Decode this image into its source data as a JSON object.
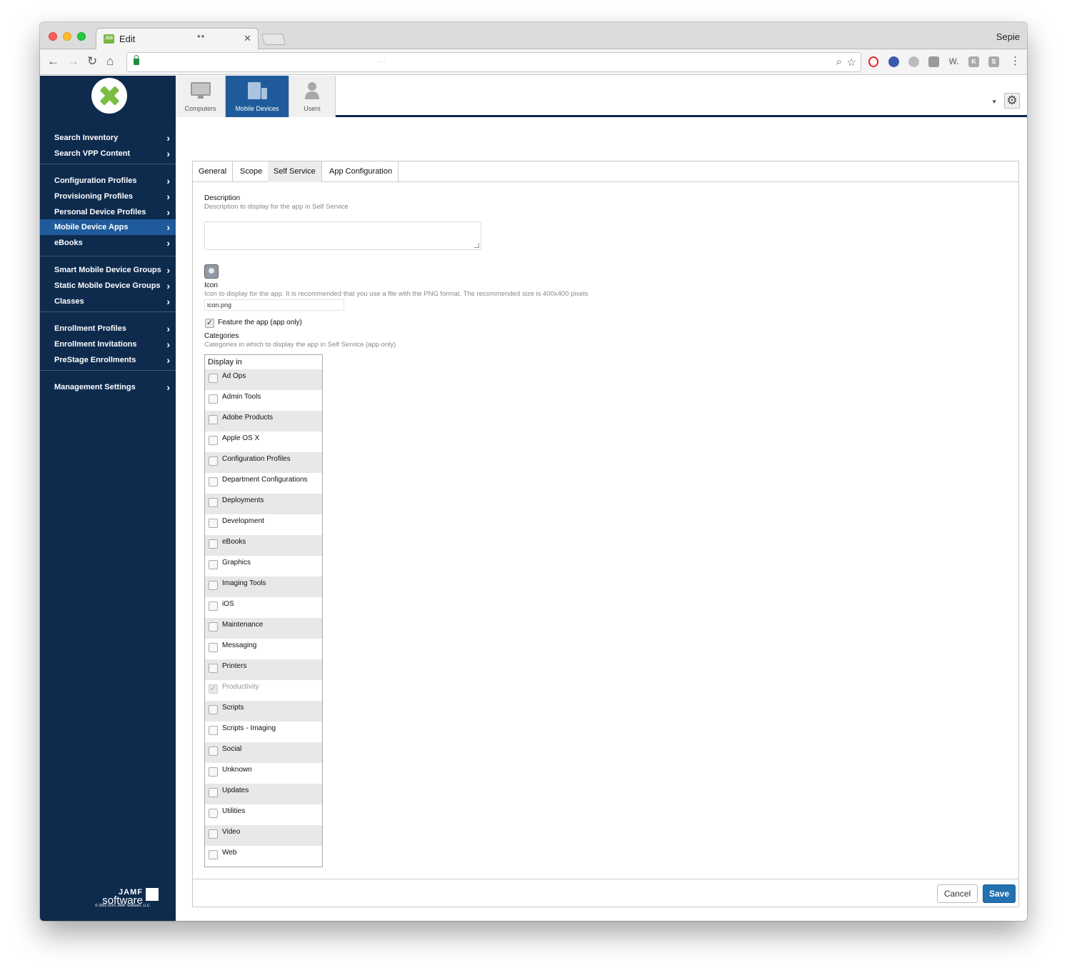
{
  "browser": {
    "tab_title": "Edit",
    "tab_stars": "**",
    "tab_favicon": "JSS",
    "profile_name": "Sepie",
    "url_text": ". ."
  },
  "colors": {
    "sidebar_bg": "#0e2b4e",
    "active_blue": "#1f5b9b",
    "save_blue": "#2271b1",
    "jamf_green": "#79bd43"
  },
  "device_tabs": [
    {
      "label": "Computers",
      "icon": "computer-icon"
    },
    {
      "label": "Mobile Devices",
      "icon": "mobile-devices-icon"
    },
    {
      "label": "Users",
      "icon": "user-icon"
    }
  ],
  "sidebar": {
    "group1": [
      "Search Inventory",
      "Search VPP Content"
    ],
    "group2": [
      "Configuration Profiles",
      "Provisioning Profiles",
      "Personal Device Profiles",
      "Mobile Device Apps",
      "eBooks"
    ],
    "group3": [
      "Smart Mobile Device Groups",
      "Static Mobile Device Groups",
      "Classes"
    ],
    "group4": [
      "Enrollment Profiles",
      "Enrollment Invitations",
      "PreStage Enrollments"
    ],
    "group5": [
      "Management Settings"
    ],
    "active_item": "Mobile Device Apps",
    "footer_logo_top": "JAMF",
    "footer_logo_bottom": "software",
    "footer_copyright": "© 2002-2016 JAMF Software, LLC."
  },
  "panel_tabs": [
    "General",
    "Scope",
    "Self Service",
    "App Configuration"
  ],
  "active_panel_tab": "Self Service",
  "form": {
    "description_label": "Description",
    "description_hint": "Description to display for the app in Self Service",
    "description_value": "",
    "icon_label": "Icon",
    "icon_hint": "Icon to display for the app. It is recommended that you use a file with the PNG format. The recommended size is 400x400 pixels",
    "icon_file": "icon.png",
    "feature_label": "Feature the app (app only)",
    "feature_checked": true,
    "categories_label": "Categories",
    "categories_hint": "Categories in which to display the app in Self Service (app only)",
    "display_in_header": "Display in",
    "categories": [
      {
        "name": "Ad Ops",
        "checked": false,
        "disabled": false
      },
      {
        "name": "Admin Tools",
        "checked": false,
        "disabled": false
      },
      {
        "name": "Adobe Products",
        "checked": false,
        "disabled": false
      },
      {
        "name": "Apple OS X",
        "checked": false,
        "disabled": false
      },
      {
        "name": "Configuration Profiles",
        "checked": false,
        "disabled": false
      },
      {
        "name": "Department Configurations",
        "checked": false,
        "disabled": false
      },
      {
        "name": "Deployments",
        "checked": false,
        "disabled": false
      },
      {
        "name": "Development",
        "checked": false,
        "disabled": false
      },
      {
        "name": "eBooks",
        "checked": false,
        "disabled": false
      },
      {
        "name": "Graphics",
        "checked": false,
        "disabled": false
      },
      {
        "name": "Imaging Tools",
        "checked": false,
        "disabled": false
      },
      {
        "name": "iOS",
        "checked": false,
        "disabled": false
      },
      {
        "name": "Maintenance",
        "checked": false,
        "disabled": false
      },
      {
        "name": "Messaging",
        "checked": false,
        "disabled": false
      },
      {
        "name": "Printers",
        "checked": false,
        "disabled": false
      },
      {
        "name": "Productivity",
        "checked": true,
        "disabled": true
      },
      {
        "name": "Scripts",
        "checked": false,
        "disabled": false
      },
      {
        "name": "Scripts - Imaging",
        "checked": false,
        "disabled": false
      },
      {
        "name": "Social",
        "checked": false,
        "disabled": false
      },
      {
        "name": "Unknown",
        "checked": false,
        "disabled": false
      },
      {
        "name": "Updates",
        "checked": false,
        "disabled": false
      },
      {
        "name": "Utilities",
        "checked": false,
        "disabled": false
      },
      {
        "name": "Video",
        "checked": false,
        "disabled": false
      },
      {
        "name": "Web",
        "checked": false,
        "disabled": false
      }
    ]
  },
  "buttons": {
    "cancel": "Cancel",
    "save": "Save"
  }
}
